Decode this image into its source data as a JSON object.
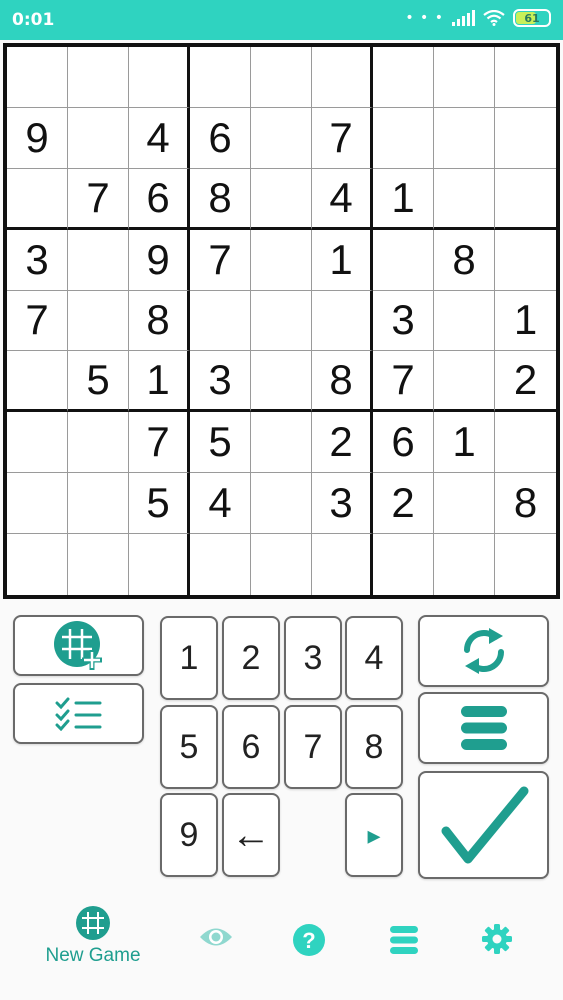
{
  "status_bar": {
    "time": "0:01",
    "battery": "61"
  },
  "board": {
    "rows": [
      [
        "",
        "",
        "",
        "",
        "",
        "",
        "",
        "",
        ""
      ],
      [
        "9",
        "",
        "4",
        "6",
        "",
        "7",
        "",
        "",
        ""
      ],
      [
        "",
        "7",
        "6",
        "8",
        "",
        "4",
        "1",
        "",
        ""
      ],
      [
        "3",
        "",
        "9",
        "7",
        "",
        "1",
        "",
        "8",
        ""
      ],
      [
        "7",
        "",
        "8",
        "",
        "",
        "",
        "3",
        "",
        "1"
      ],
      [
        "",
        "5",
        "1",
        "3",
        "",
        "8",
        "7",
        "",
        "2"
      ],
      [
        "",
        "",
        "7",
        "5",
        "",
        "2",
        "6",
        "1",
        ""
      ],
      [
        "",
        "",
        "5",
        "4",
        "",
        "3",
        "2",
        "",
        "8"
      ],
      [
        "",
        "",
        "",
        "",
        "",
        "",
        "",
        "",
        ""
      ]
    ]
  },
  "keypad": {
    "k1": "1",
    "k2": "2",
    "k3": "3",
    "k4": "4",
    "k5": "5",
    "k6": "6",
    "k7": "7",
    "k8": "8",
    "k9": "9",
    "backspace": "←",
    "next": "▸"
  },
  "bottom_nav": {
    "new_game": "New Game"
  },
  "colors": {
    "accent": "#1f9e8f",
    "statusbar": "#2fd3c0",
    "icon_light": "#2fd3c0"
  }
}
